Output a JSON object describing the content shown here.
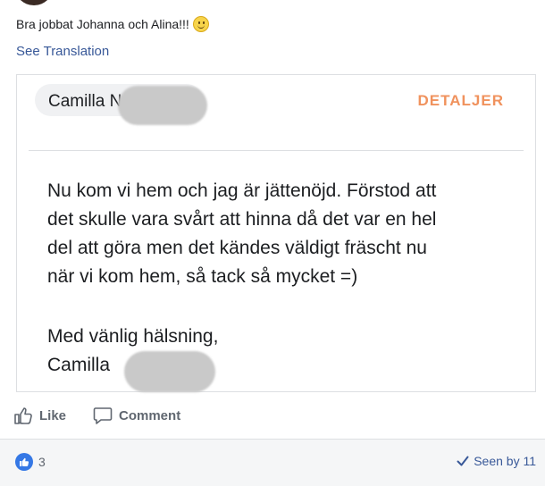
{
  "post": {
    "text": "Bra jobbat Johanna och Alina!!!",
    "emoji": "slightly-smiling-face",
    "see_translation": "See Translation"
  },
  "review_card": {
    "reviewer_name": "Camilla N",
    "details_label": "DETALJER",
    "body_lines": [
      "Nu kom vi hem och jag är jättenöjd. Förstod att",
      "det skulle vara svårt att hinna då det var en hel",
      "del att göra men det kändes väldigt fräscht nu",
      "när vi kom hem, så tack så mycket =)"
    ],
    "signoff_greeting": "Med vänlig hälsning,",
    "signoff_name": "Camilla"
  },
  "actions": {
    "like_label": "Like",
    "comment_label": "Comment"
  },
  "footer": {
    "reaction_count": "3",
    "seen_by": "Seen by 11"
  },
  "colors": {
    "link": "#385898",
    "details_accent": "#f0925d",
    "like_badge": "#3578e5"
  }
}
